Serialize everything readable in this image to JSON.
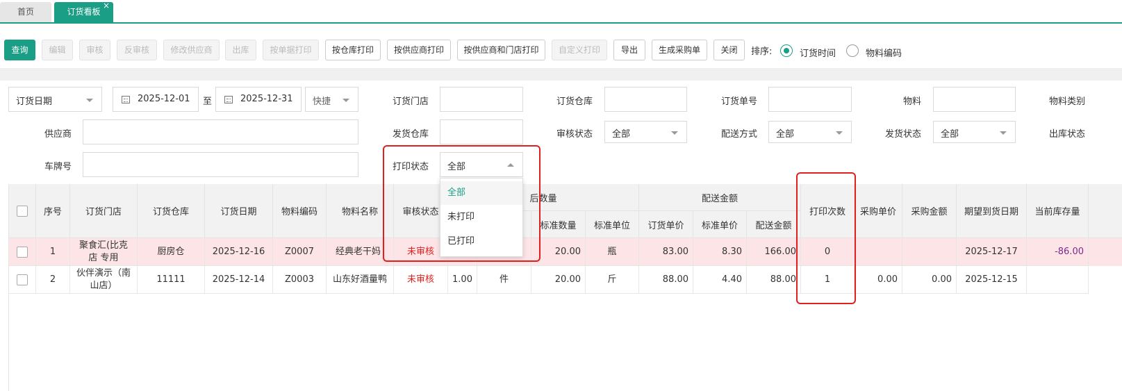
{
  "tabs": [
    {
      "label": "首页"
    },
    {
      "label": "订货看板",
      "close": "×"
    }
  ],
  "toolbar": {
    "buttons": [
      {
        "label": "查询"
      },
      {
        "label": "编辑"
      },
      {
        "label": "审核"
      },
      {
        "label": "反审核"
      },
      {
        "label": "修改供应商"
      },
      {
        "label": "出库"
      },
      {
        "label": "按单据打印"
      },
      {
        "label": "按仓库打印"
      },
      {
        "label": "按供应商打印"
      },
      {
        "label": "按供应商和门店打印"
      },
      {
        "label": "自定义打印"
      },
      {
        "label": "导出"
      },
      {
        "label": "生成采购单"
      },
      {
        "label": "关闭"
      }
    ],
    "sort_label": "排序:",
    "sort_options": [
      {
        "label": "订货时间",
        "selected": true
      },
      {
        "label": "物料编码",
        "selected": false
      }
    ]
  },
  "filters": {
    "date_type": "订货日期",
    "date_from": "2025-12-01",
    "to_label": "至",
    "date_to": "2025-12-31",
    "quick": "快捷",
    "store_label": "订货门店",
    "warehouse_label": "订货仓库",
    "order_no_label": "订货单号",
    "material_label": "物料",
    "material_cat_label": "物料类别",
    "supplier_label": "供应商",
    "ship_wh_label": "发货仓库",
    "audit_label": "审核状态",
    "audit_value": "全部",
    "delivery_label": "配送方式",
    "delivery_value": "全部",
    "ship_status_label": "发货状态",
    "ship_status_value": "全部",
    "outbound_label": "出库状态",
    "plate_label": "车牌号",
    "print_label": "打印状态",
    "print_value": "全部"
  },
  "print_dropdown": {
    "options": [
      "全部",
      "未打印",
      "已打印"
    ]
  },
  "table": {
    "headers": {
      "seq": "序号",
      "store": "订货门店",
      "warehouse": "订货仓库",
      "date": "订货日期",
      "code": "物料编码",
      "name": "物料名称",
      "audit": "审核状态",
      "converted_group": "后数量",
      "std_qty": "标准数量",
      "std_unit": "标准单位",
      "amount_group": "配送金额",
      "order_price": "订货单价",
      "std_price": "标准单价",
      "amount": "配送金额",
      "print_count": "打印次数",
      "purchase_price": "采购单价",
      "purchase_amount": "采购金额",
      "expected_date": "期望到货日期",
      "stock": "当前库存量"
    },
    "rows": [
      {
        "seq": "1",
        "store": "聚食汇(比克店  专用",
        "warehouse": "厨房仓",
        "date": "2025-12-16",
        "code": "Z0007",
        "name": "经典老干妈",
        "audit": "未审核",
        "qty": "",
        "unit": "",
        "std_qty": "20.00",
        "std_unit": "瓶",
        "order_price": "83.00",
        "std_price": "8.30",
        "amount": "166.00",
        "print_count": "0",
        "purchase_price": "",
        "purchase_amount": "",
        "expected_date": "2025-12-17",
        "stock": "-86.00"
      },
      {
        "seq": "2",
        "store": "伙伴演示（南山店）",
        "warehouse": "11111",
        "date": "2025-12-14",
        "code": "Z0003",
        "name": "山东好酒量鸭",
        "audit": "未审核",
        "qty": "1.00",
        "unit": "件",
        "std_qty": "20.00",
        "std_unit": "斤",
        "order_price": "88.00",
        "std_price": "4.40",
        "amount": "88.00",
        "print_count": "1",
        "purchase_price": "0.00",
        "purchase_amount": "0.00",
        "expected_date": "2025-12-15",
        "stock": ""
      }
    ]
  },
  "colors": {
    "accent": "#1b9e86",
    "highlight": "#e02020",
    "row_pink": "#fde4e6"
  }
}
